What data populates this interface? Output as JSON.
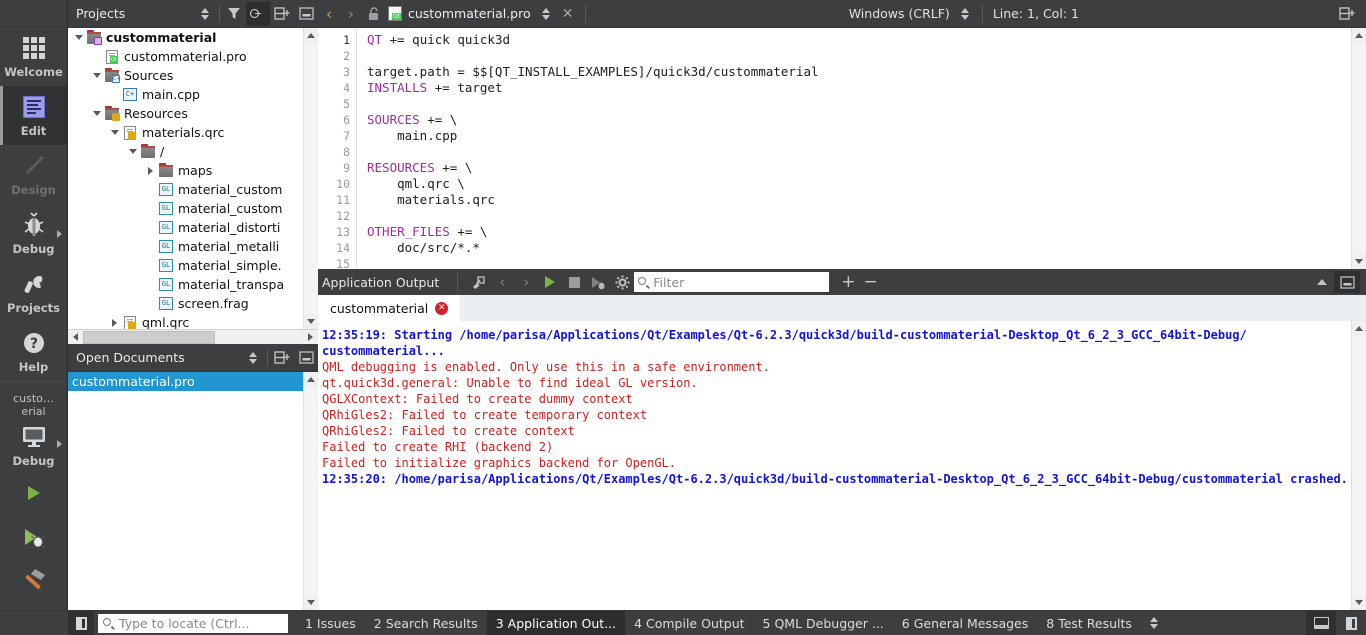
{
  "modebar": {
    "items": [
      {
        "label": "Welcome",
        "icon": "grid-icon",
        "state": "normal"
      },
      {
        "label": "Edit",
        "icon": "edit-lines-icon",
        "state": "active"
      },
      {
        "label": "Design",
        "icon": "pencil-icon",
        "state": "disabled"
      },
      {
        "label": "Debug",
        "icon": "bug-icon",
        "state": "normal"
      },
      {
        "label": "Projects",
        "icon": "wrench-icon",
        "state": "normal"
      },
      {
        "label": "Help",
        "icon": "question-mark-icon",
        "state": "normal"
      }
    ],
    "kit_name": "custo…erial",
    "run_config_label": "Debug",
    "run_buttons": [
      {
        "name": "run-button",
        "icon": "green-play-icon"
      },
      {
        "name": "start-debugging-button",
        "icon": "play-bug-icon"
      },
      {
        "name": "build-button",
        "icon": "hammer-icon"
      }
    ]
  },
  "projects_pane": {
    "title": "Projects",
    "buttons": [
      {
        "name": "filter-button",
        "icon": "funnel-icon"
      },
      {
        "name": "synchronize-button",
        "icon": "link-icon",
        "active": true
      },
      {
        "name": "split-button",
        "icon": "split-icon"
      },
      {
        "name": "close-sidebar-button",
        "icon": "minimize-icon"
      }
    ],
    "tree": [
      {
        "depth": 0,
        "twisty": "down",
        "icon": "project-qt-icon",
        "label": "custommaterial",
        "bold": true
      },
      {
        "depth": 1,
        "twisty": "none",
        "icon": "pro-file-icon",
        "label": "custommaterial.pro",
        "bold": false
      },
      {
        "depth": 1,
        "twisty": "down",
        "icon": "sources-folder-icon",
        "label": "Sources",
        "bold": false
      },
      {
        "depth": 2,
        "twisty": "none",
        "icon": "cpp-file-icon",
        "label": "main.cpp",
        "bold": false
      },
      {
        "depth": 1,
        "twisty": "down",
        "icon": "resources-folder-icon",
        "label": "Resources",
        "bold": false
      },
      {
        "depth": 2,
        "twisty": "down",
        "icon": "qrc-file-icon",
        "label": "materials.qrc",
        "bold": false
      },
      {
        "depth": 3,
        "twisty": "down",
        "icon": "folder-icon",
        "label": "/",
        "bold": false
      },
      {
        "depth": 4,
        "twisty": "right",
        "icon": "folder-icon",
        "label": "maps",
        "bold": false
      },
      {
        "depth": 4,
        "twisty": "none",
        "icon": "gl-file-icon",
        "label": "material_custom",
        "bold": false
      },
      {
        "depth": 4,
        "twisty": "none",
        "icon": "gl-file-icon",
        "label": "material_custom",
        "bold": false
      },
      {
        "depth": 4,
        "twisty": "none",
        "icon": "gl-file-icon",
        "label": "material_distorti",
        "bold": false
      },
      {
        "depth": 4,
        "twisty": "none",
        "icon": "gl-file-icon",
        "label": "material_metalli",
        "bold": false
      },
      {
        "depth": 4,
        "twisty": "none",
        "icon": "gl-file-icon",
        "label": "material_simple.",
        "bold": false
      },
      {
        "depth": 4,
        "twisty": "none",
        "icon": "gl-file-icon",
        "label": "material_transpa",
        "bold": false
      },
      {
        "depth": 4,
        "twisty": "none",
        "icon": "gl-file-icon",
        "label": "screen.frag",
        "bold": false
      },
      {
        "depth": 2,
        "twisty": "right",
        "icon": "qrc-file-icon",
        "label": "qml.qrc",
        "bold": false
      }
    ]
  },
  "open_documents": {
    "title": "Open Documents",
    "buttons": [
      {
        "name": "split-button",
        "icon": "split-icon"
      },
      {
        "name": "close-pane-button",
        "icon": "minimize-icon"
      }
    ],
    "items": [
      {
        "label": "custommaterial.pro",
        "selected": true
      }
    ]
  },
  "editor_toolbar": {
    "back_icon": "chevron-left-icon",
    "forward_icon": "chevron-right-icon",
    "lock_icon": "unlocked-icon",
    "file_icon": "qt-pro-file-icon",
    "file_name": "custommaterial.pro",
    "dropdown_icon": "updown-arrows-icon",
    "close_label": "✕",
    "line_ending": "Windows (CRLF)",
    "cursor_position": "Line: 1, Col: 1",
    "split_icon": "split-icon"
  },
  "editor": {
    "lines": [
      {
        "n": "1",
        "segments": [
          {
            "t": "QT",
            "c": "kw"
          },
          {
            "t": " += quick quick3d",
            "c": "pl"
          }
        ]
      },
      {
        "n": "2",
        "segments": []
      },
      {
        "n": "3",
        "segments": [
          {
            "t": "target.path = $$[QT_INSTALL_EXAMPLES]/quick3d/custommaterial",
            "c": "pl"
          }
        ]
      },
      {
        "n": "4",
        "segments": [
          {
            "t": "INSTALLS",
            "c": "kw"
          },
          {
            "t": " += target",
            "c": "pl"
          }
        ]
      },
      {
        "n": "5",
        "segments": []
      },
      {
        "n": "6",
        "segments": [
          {
            "t": "SOURCES",
            "c": "kw"
          },
          {
            "t": " += \\",
            "c": "pl"
          }
        ]
      },
      {
        "n": "7",
        "segments": [
          {
            "t": "    main.cpp",
            "c": "pl"
          }
        ]
      },
      {
        "n": "8",
        "segments": []
      },
      {
        "n": "9",
        "segments": [
          {
            "t": "RESOURCES",
            "c": "kw"
          },
          {
            "t": " += \\",
            "c": "pl"
          }
        ]
      },
      {
        "n": "10",
        "segments": [
          {
            "t": "    qml.qrc \\",
            "c": "pl"
          }
        ]
      },
      {
        "n": "11",
        "segments": [
          {
            "t": "    materials.qrc",
            "c": "pl"
          }
        ]
      },
      {
        "n": "12",
        "segments": []
      },
      {
        "n": "13",
        "segments": [
          {
            "t": "OTHER_FILES",
            "c": "kw"
          },
          {
            "t": " += \\",
            "c": "pl"
          }
        ]
      },
      {
        "n": "14",
        "segments": [
          {
            "t": "    doc/src/*.*",
            "c": "pl"
          }
        ]
      },
      {
        "n": "15",
        "segments": []
      }
    ]
  },
  "output_pane": {
    "title": "Application Output",
    "buttons": [
      {
        "name": "clean-output-button",
        "icon": "broom-icon"
      },
      {
        "name": "prev-item-button",
        "icon": "chevron-left-icon"
      },
      {
        "name": "next-item-button",
        "icon": "chevron-right-icon"
      },
      {
        "name": "rerun-button",
        "icon": "green-play-icon"
      },
      {
        "name": "stop-button",
        "icon": "stop-square-icon"
      },
      {
        "name": "attach-debugger-button",
        "icon": "play-bug-icon"
      },
      {
        "name": "settings-button",
        "icon": "gear-icon"
      }
    ],
    "filter_placeholder": "Filter",
    "filter_value": "",
    "zoom_in_label": "+",
    "zoom_out_label": "−",
    "minimize_icon": "chevron-up-icon",
    "close_icon": "minimize-icon",
    "tab": {
      "label": "custommaterial",
      "status_icon": "error-close-icon",
      "status_glyph": "✕"
    },
    "lines": [
      {
        "cls": "oi",
        "text": "12:35:19: Starting /home/parisa/Applications/Qt/Examples/Qt-6.2.3/quick3d/build-custommaterial-Desktop_Qt_6_2_3_GCC_64bit-Debug/"
      },
      {
        "cls": "oi",
        "text": "custommaterial..."
      },
      {
        "cls": "oe",
        "text": "QML debugging is enabled. Only use this in a safe environment."
      },
      {
        "cls": "oe",
        "text": "qt.quick3d.general: Unable to find ideal GL version."
      },
      {
        "cls": "oe",
        "text": "QGLXContext: Failed to create dummy context"
      },
      {
        "cls": "oe",
        "text": "QRhiGles2: Failed to create temporary context"
      },
      {
        "cls": "oe",
        "text": "QRhiGles2: Failed to create context"
      },
      {
        "cls": "oe",
        "text": "Failed to create RHI (backend 2)"
      },
      {
        "cls": "oe",
        "text": "Failed to initialize graphics backend for OpenGL."
      },
      {
        "cls": "oi",
        "text": "12:35:20: /home/parisa/Applications/Qt/Examples/Qt-6.2.3/quick3d/build-custommaterial-Desktop_Qt_6_2_3_GCC_64bit-Debug/custommaterial crashed."
      }
    ]
  },
  "statusbar": {
    "sidebar_toggle_icon": "sidebar-toggle-icon",
    "locator_placeholder": "Type to locate (Ctrl...",
    "locator_value": "",
    "search_icon": "search-icon",
    "tabs": [
      {
        "label": "1 Issues",
        "active": false
      },
      {
        "label": "2 Search Results",
        "active": false
      },
      {
        "label": "3 Application Out...",
        "active": true
      },
      {
        "label": "4 Compile Output",
        "active": false
      },
      {
        "label": "5 QML Debugger ...",
        "active": false
      },
      {
        "label": "6 General Messages",
        "active": false
      },
      {
        "label": "8 Test Results",
        "active": false
      }
    ],
    "more_icon": "updown-arrows-icon",
    "right_buttons": [
      {
        "name": "output-pane-toggle-button",
        "icon": "window-bottom-icon"
      },
      {
        "name": "sidebar-right-toggle-button",
        "icon": "sidebar-toggle-icon"
      }
    ]
  },
  "colors": {
    "chrome": "#3c3e40",
    "chrome_dark": "#2b2d2f",
    "selection_blue": "#2196d1",
    "error_red": "#cc2222",
    "info_blue": "#1414d2",
    "keyword_purple": "#9d2fa0",
    "green_play": "#7cb342"
  }
}
